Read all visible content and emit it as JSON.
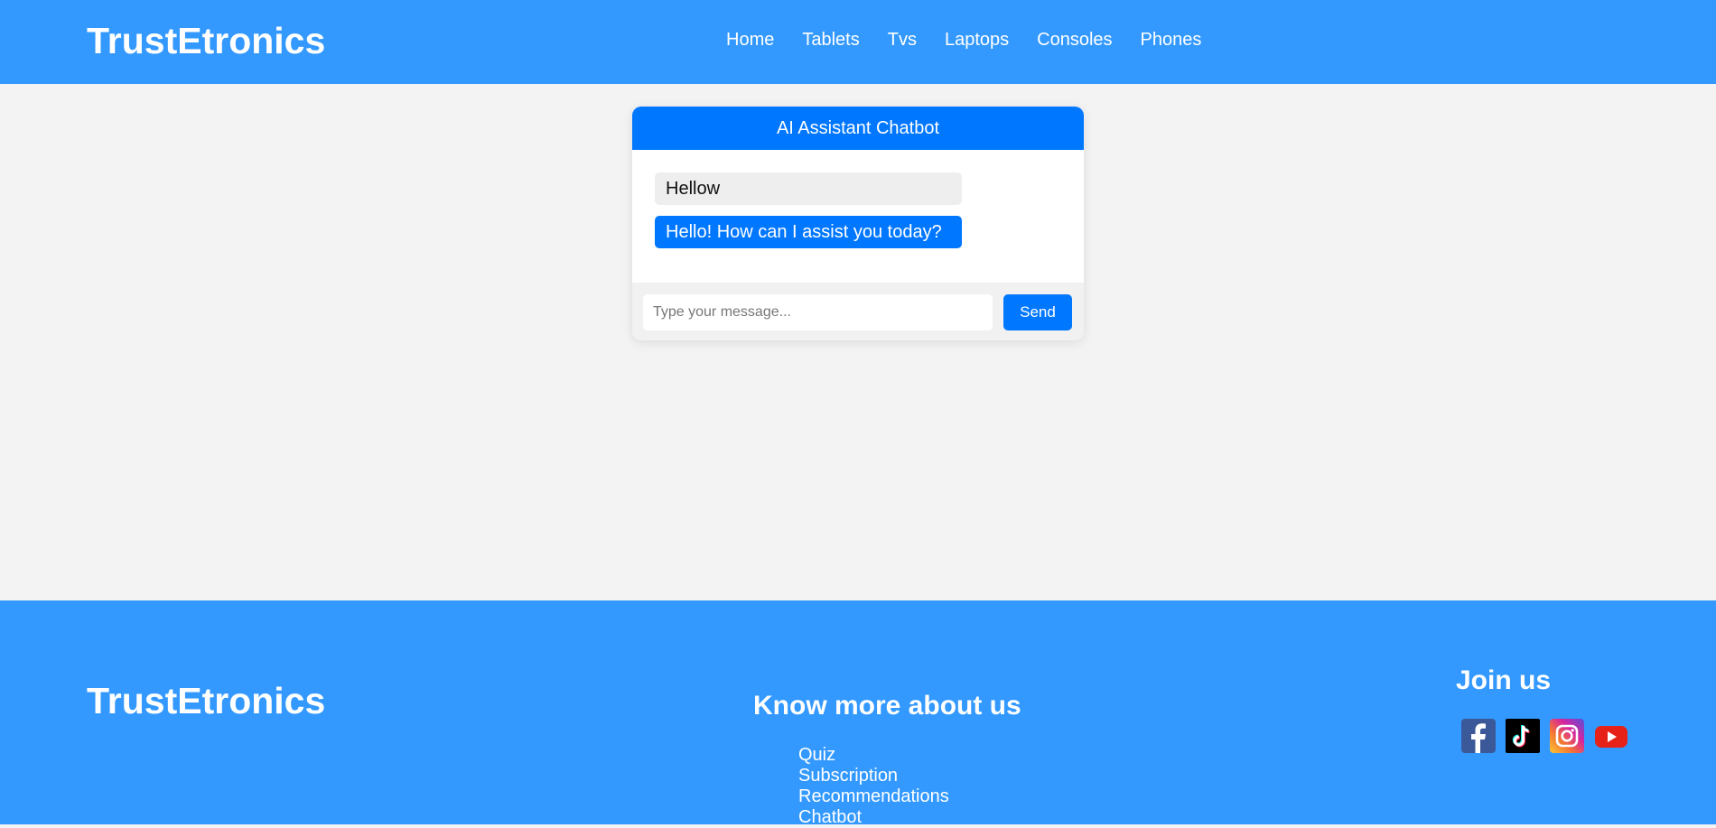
{
  "header": {
    "logo": "TrustEtronics",
    "nav": [
      "Home",
      "Tablets",
      "Tvs",
      "Laptops",
      "Consoles",
      "Phones"
    ]
  },
  "chat": {
    "title": "AI Assistant Chatbot",
    "messages": [
      {
        "role": "user",
        "text": "Hellow"
      },
      {
        "role": "bot",
        "text": "Hello! How can I assist you today?"
      }
    ],
    "input_placeholder": "Type your message...",
    "send_label": "Send"
  },
  "footer": {
    "logo": "TrustEtronics",
    "about_title": "Know more about us",
    "links": [
      "Quiz",
      "Subscription",
      "Recommendations",
      "Chatbot"
    ],
    "join_title": "Join us",
    "socials": [
      "facebook-icon",
      "tiktok-icon",
      "instagram-icon",
      "youtube-icon"
    ]
  },
  "colors": {
    "primary": "#3399ff",
    "accent": "#0077ff",
    "background": "#f3f3f3"
  }
}
